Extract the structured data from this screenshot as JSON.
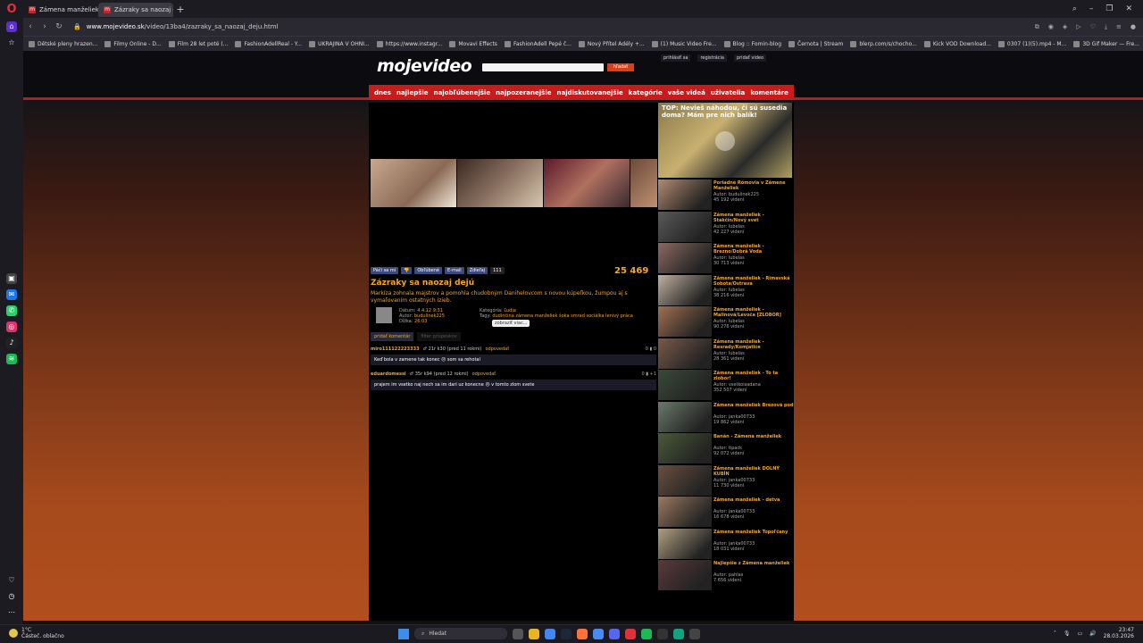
{
  "browser": {
    "tabs": [
      {
        "title": "Zámena manželiek - Stal"
      },
      {
        "title": "Zázraky sa naozaj dejú - I"
      }
    ],
    "url": {
      "host": "www.mojevideo.sk",
      "path": "/video/13ba4/zazraky_sa_naozaj_deju.html"
    },
    "bookmarks": [
      "Dětské pleny hrazen...",
      "Filmy Online - D...",
      "Film 28 let poté (...",
      "FashionAdellReal - Y...",
      "UKRAJINA V OHNI...",
      "https://www.instagr...",
      "Movavi Effects",
      "FashionAdell Pepé č...",
      "Nový Přítel Adély +...",
      "(1) Music Video Fre...",
      "Blog :: Fomin-blog",
      "Černota | Stream",
      "blerp.com/s/chocho...",
      "Kick VOD Download...",
      "0307 (1)(5).mp4 - M...",
      "3D Gif Maker — Fre..."
    ]
  },
  "site": {
    "logo": "mojevideo",
    "search_button": "hľadať",
    "toplinks": [
      "prihlásiť sa",
      "registrácia",
      "pridať video"
    ],
    "nav": [
      "dnes",
      "najlepšie",
      "najobľúbenejšie",
      "najpozeranejšie",
      "najdiskutovanejšie",
      "kategórie",
      "vaše videá",
      "uživatelia",
      "komentáre"
    ]
  },
  "video": {
    "actions": [
      "Páči sa mi",
      "Obľúbené",
      "E-mail",
      "Zdieľaj",
      "111"
    ],
    "views": "25 469",
    "title": "Zázraky sa naozaj dejú",
    "description": "Markíza zohnala majstrov a pomohla chudobným Danihelovcom s novou kúpeľkou, žumpou aj s vymaľovaním ostatných izieb.",
    "date_label": "Dátum:",
    "date": "4.4.12 9:31",
    "author_label": "Autor:",
    "author": "budulinek225",
    "length_label": "Dĺžka:",
    "length": "26:03",
    "category_label": "Kategória:",
    "category": "Ľudia",
    "tags_label": "Tagy:",
    "tags": "dudinčina zámena manželiek šoka smrad sociálka lenivý práca",
    "tooltip": "zobraziť viac..."
  },
  "comments": {
    "tab_add": "pridať komentár",
    "tab_filter": "filter príspevkov",
    "items": [
      {
        "user": "miro111122223333",
        "meta": "♂ 21r k30 (pred 11 rokmi)",
        "reply": "odpovedať",
        "votes": "0 ▮ 0",
        "text": "Keď bola v zamene tak konec 😐 som sa rehotal"
      },
      {
        "user": "eduardomessi",
        "meta": "♂ 35r k94 (pred 12 rokmi)",
        "reply": "odpovedať",
        "votes": "0 ▮ +1",
        "text": "prajem im vsetko naj nech sa im dari uz konecne 😐 v tomto zlom svete"
      }
    ]
  },
  "sidebar": {
    "top_title": "TOP: Nevieš náhodou, či sú susedia doma? Mám pre nich balík!",
    "related": [
      {
        "title": "Poriadné Rómovia v Zámene Manželiek",
        "author": "Autor: budulinek225",
        "views": "45 192 videní"
      },
      {
        "title": "Zámena manželiek - Stakčín/Nový svet",
        "author": "Autor: lubelas",
        "views": "42 227 videní"
      },
      {
        "title": "Zámena manželiek - Brezno/Dobrá Voda",
        "author": "Autor: lubelas",
        "views": "30 713 videní"
      },
      {
        "title": "Zámena manželiek - Rimavská Sobota/Ostrava",
        "author": "Autor: lubelas",
        "views": "38 216 videní"
      },
      {
        "title": "Zámena manželiek - Malinová/Levoča [ZLOBOR]",
        "author": "Autor: lubelas",
        "views": "90 276 videní"
      },
      {
        "title": "Zámena manželiek - Resrady/Komjatice",
        "author": "Autor: lubelas",
        "views": "28 361 videní"
      },
      {
        "title": "Zámena manželiek - To ta zlobor!",
        "author": "Autor: vsetkoisadana",
        "views": "352 507 videní"
      },
      {
        "title": "Zámena manželiek Brezová pod",
        "author": "Autor: janka00733",
        "views": "19 862 videní"
      },
      {
        "title": "Banán - Zámena manželiek",
        "author": "Autor: tipack",
        "views": "92 072 videní"
      },
      {
        "title": "Zámena manželiek DOLNÝ KUBÍN",
        "author": "Autor: janka00733",
        "views": "11 730 videní"
      },
      {
        "title": "Zámena manželiek - detva",
        "author": "Autor: janka00733",
        "views": "16 678 videní"
      },
      {
        "title": "Zámena manželiek Topoľčany",
        "author": "Autor: janka00733",
        "views": "18 031 videní"
      },
      {
        "title": "Najlepšie z Zámena manželiek",
        "author": "Autor: pahlas",
        "views": "7 656 videní"
      }
    ]
  },
  "taskbar": {
    "weather_temp": "1°C",
    "weather_desc": "Částeč. oblačno",
    "search": "Hledat",
    "time": "23:47",
    "date": "28.03.2026"
  }
}
